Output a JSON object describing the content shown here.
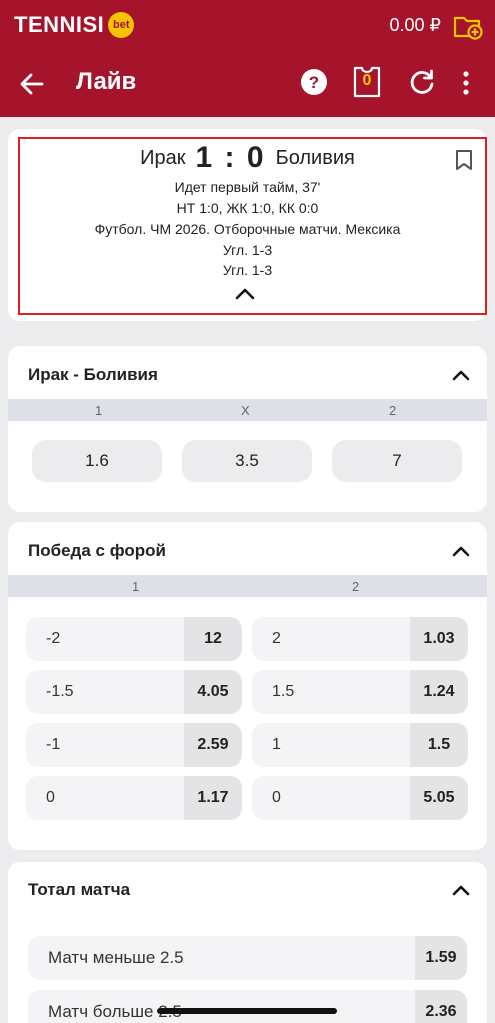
{
  "header": {
    "logo_text": "TENNISI",
    "logo_badge": "bet",
    "balance": "0.00 ₽"
  },
  "nav": {
    "title": "Лайв",
    "coupon_count": "0"
  },
  "match": {
    "home_team": "Ирак",
    "score": "1 : 0",
    "away_team": "Боливия",
    "lines": [
      "Идет первый тайм, 37'",
      "НТ 1:0, ЖК 1:0, КК 0:0",
      "Футбол. ЧМ 2026. Отборочные матчи. Мексика",
      "Угл. 1-3",
      "Угл. 1-3"
    ]
  },
  "market_1x2": {
    "title": "Ирак - Боливия",
    "columns": [
      "1",
      "X",
      "2"
    ],
    "odds": [
      "1.6",
      "3.5",
      "7"
    ]
  },
  "market_handicap": {
    "title": "Победа с форой",
    "columns": [
      "1",
      "2"
    ],
    "rows": [
      {
        "left_label": "-2",
        "left_odd": "12",
        "right_label": "2",
        "right_odd": "1.03"
      },
      {
        "left_label": "-1.5",
        "left_odd": "4.05",
        "right_label": "1.5",
        "right_odd": "1.24"
      },
      {
        "left_label": "-1",
        "left_odd": "2.59",
        "right_label": "1",
        "right_odd": "1.5"
      },
      {
        "left_label": "0",
        "left_odd": "1.17",
        "right_label": "0",
        "right_odd": "5.05"
      }
    ]
  },
  "market_total": {
    "title": "Тотал матча",
    "rows": [
      {
        "label": "Матч меньше 2.5",
        "odd": "1.59"
      },
      {
        "label": "Матч больше 2.5",
        "odd": "2.36"
      }
    ]
  },
  "colors": {
    "brand": "#a5142a",
    "accent": "#f5c400",
    "highlight": "#e02020"
  }
}
